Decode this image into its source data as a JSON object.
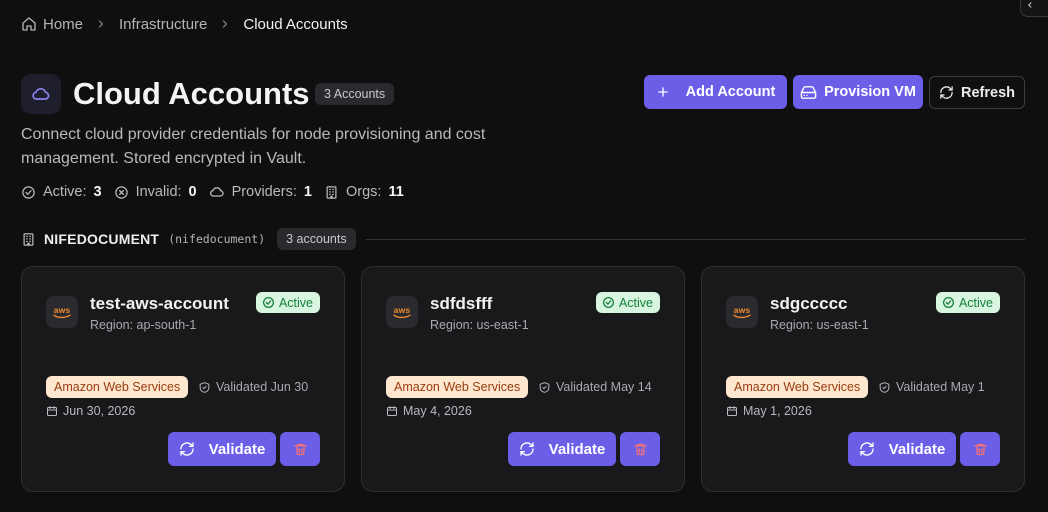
{
  "breadcrumb": [
    "Home",
    "Infrastructure",
    "Cloud Accounts"
  ],
  "header": {
    "title": "Cloud Accounts",
    "count_badge": "3 Accounts",
    "description": "Connect cloud provider credentials for node provisioning and cost management. Stored encrypted in Vault."
  },
  "stats": [
    {
      "label": "Active:",
      "value": "3",
      "icon": "check-circle-icon"
    },
    {
      "label": "Invalid:",
      "value": "0",
      "icon": "x-circle-icon"
    },
    {
      "label": "Providers:",
      "value": "1",
      "icon": "cloud-icon"
    },
    {
      "label": "Orgs:",
      "value": "11",
      "icon": "building-icon"
    }
  ],
  "actions": {
    "add": "Add Account",
    "provision": "Provision VM",
    "refresh": "Refresh"
  },
  "org": {
    "name": "NIFEDOCUMENT",
    "slug": "(nifedocument)",
    "badge": "3 accounts"
  },
  "cards": [
    {
      "name": "test-aws-account",
      "region": "Region: ap-south-1",
      "status": "Active",
      "provider_tag": "Amazon Web Services",
      "validated": "Validated Jun 30",
      "date": "Jun 30, 2026",
      "logo_text": "aws"
    },
    {
      "name": "sdfdsfff",
      "region": "Region: us-east-1",
      "status": "Active",
      "provider_tag": "Amazon Web Services",
      "validated": "Validated May 14",
      "date": "May 4, 2026",
      "logo_text": "aws"
    },
    {
      "name": "sdgccccc",
      "region": "Region: us-east-1",
      "status": "Active",
      "provider_tag": "Amazon Web Services",
      "validated": "Validated May 1",
      "date": "May 1, 2026",
      "logo_text": "aws"
    }
  ],
  "card_action": "Validate",
  "colors": {
    "background": "#0f0f10",
    "card": "#19191b",
    "accent": "#6b5fe8",
    "active_badge_bg": "#d7f5df",
    "active_badge_text": "#15803d",
    "provider_tag_bg": "#fde7cf",
    "provider_tag_text": "#9a3c0f",
    "aws_orange": "#f08a2a"
  }
}
